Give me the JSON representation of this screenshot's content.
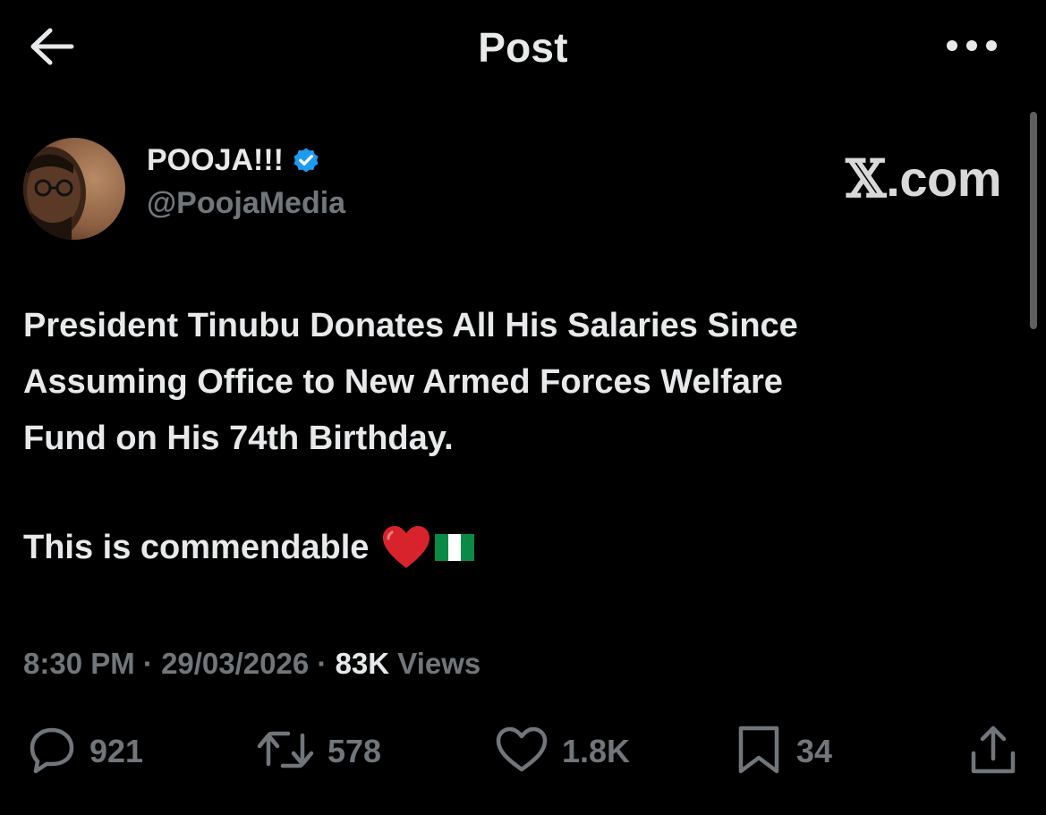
{
  "header": {
    "title": "Post",
    "back_icon": "arrow-left-icon",
    "more_icon": "more-dots-icon"
  },
  "author": {
    "display_name": "POOJA!!!",
    "handle": "@PoojaMedia",
    "verified": true,
    "verified_color": "#1d9bf0"
  },
  "watermark": {
    "x_glyph": "𝕏",
    "text": ".com"
  },
  "tweet": {
    "lines": [
      "President Tinubu Donates All His Salaries Since",
      "Assuming Office to New Armed Forces Welfare",
      "Fund on His 74th Birthday."
    ],
    "closing": "This is commendable",
    "emojis": [
      "heart-emoji",
      "nigeria-flag-emoji"
    ]
  },
  "meta": {
    "time": "8:30 PM",
    "date": "29/03/2026",
    "views_count": "83K",
    "views_label": "Views",
    "separator": "·"
  },
  "actions": {
    "replies": "921",
    "reposts": "578",
    "likes": "1.8K",
    "bookmarks": "34"
  },
  "colors": {
    "background": "#000000",
    "text_primary": "#e7e9ea",
    "text_secondary": "#71767b",
    "accent": "#1d9bf0"
  }
}
